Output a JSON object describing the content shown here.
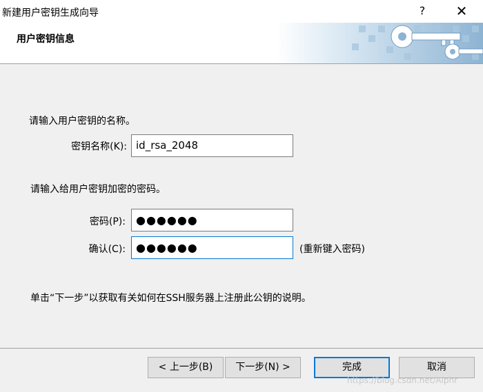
{
  "window": {
    "title": "新建用户密钥生成向导",
    "help_label": "?",
    "close_label": "✕"
  },
  "header": {
    "title": "用户密钥信息",
    "art_icon": "key-icon"
  },
  "content": {
    "name_instruction": "请输入用户密钥的名称。",
    "name_label": "密钥名称(K):",
    "name_value": "id_rsa_2048",
    "password_instruction": "请输入给用户密钥加密的密码。",
    "password_label": "密码(P):",
    "password_value": "●●●●●●",
    "confirm_label": "确认(C):",
    "confirm_value": "●●●●●●",
    "confirm_hint": "(重新键入密码)",
    "next_hint": "单击“下一步”以获取有关如何在SSH服务器上注册此公钥的说明。"
  },
  "buttons": {
    "back": "< 上一步(B)",
    "next": "下一步(N) >",
    "finish": "完成",
    "cancel": "取消"
  },
  "watermark": "https://blog.csdn.net/Alphr",
  "colors": {
    "focus_border": "#0078d7",
    "dialog_bg": "#f0f0f0"
  }
}
